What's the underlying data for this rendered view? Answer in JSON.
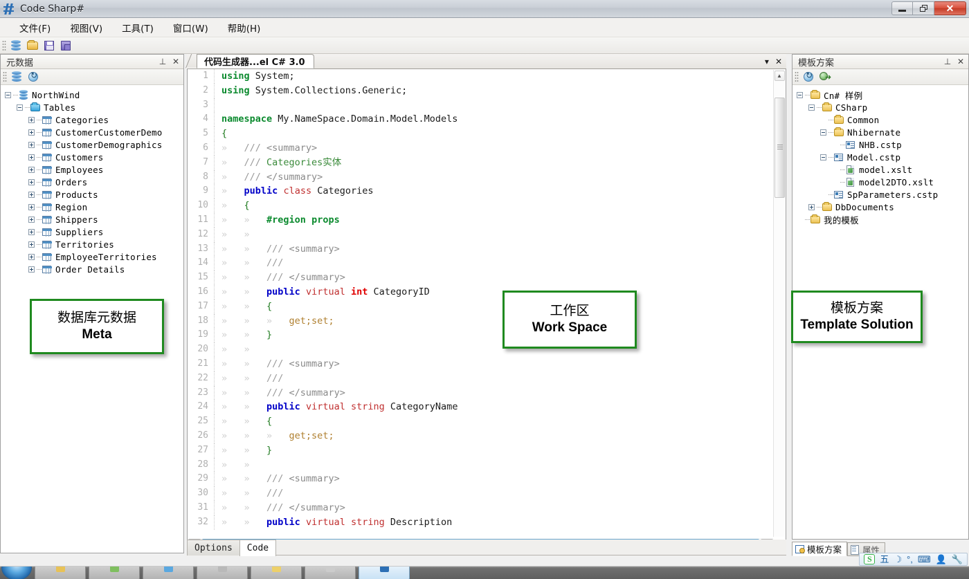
{
  "window": {
    "title": "Code Sharp#",
    "icon": "hash-logo-icon",
    "minimize_label": "",
    "restore_label": "",
    "close_label": "✕"
  },
  "menu": {
    "items": [
      {
        "label": "文件(F)",
        "name": "menu-file"
      },
      {
        "label": "视图(V)",
        "name": "menu-view"
      },
      {
        "label": "工具(T)",
        "name": "menu-tools"
      },
      {
        "label": "窗口(W)",
        "name": "menu-window"
      },
      {
        "label": "帮助(H)",
        "name": "menu-help"
      }
    ]
  },
  "toolbar": {
    "buttons": [
      {
        "icon": "database-icon",
        "name": "toolbar-connect-database"
      },
      {
        "icon": "open-folder-icon",
        "name": "toolbar-open"
      },
      {
        "icon": "save-icon",
        "name": "toolbar-save"
      },
      {
        "icon": "save-all-icon",
        "name": "toolbar-save-all"
      }
    ]
  },
  "left_panel": {
    "title": "元数据",
    "pin_glyph": "⊥",
    "close_glyph": "✕",
    "toolbar": [
      {
        "icon": "database-icon",
        "name": "meta-database-button"
      },
      {
        "icon": "refresh-icon",
        "name": "meta-refresh-button"
      }
    ],
    "tree": [
      {
        "label": "NorthWind",
        "depth": 0,
        "toggle": "minus",
        "icon": "database-icon"
      },
      {
        "label": "Tables",
        "depth": 1,
        "toggle": "minus",
        "icon": "folder-blue-icon"
      },
      {
        "label": "Categories",
        "depth": 2,
        "toggle": "plus",
        "icon": "table-icon"
      },
      {
        "label": "CustomerCustomerDemo",
        "depth": 2,
        "toggle": "plus",
        "icon": "table-icon"
      },
      {
        "label": "CustomerDemographics",
        "depth": 2,
        "toggle": "plus",
        "icon": "table-icon"
      },
      {
        "label": "Customers",
        "depth": 2,
        "toggle": "plus",
        "icon": "table-icon"
      },
      {
        "label": "Employees",
        "depth": 2,
        "toggle": "plus",
        "icon": "table-icon"
      },
      {
        "label": "Orders",
        "depth": 2,
        "toggle": "plus",
        "icon": "table-icon"
      },
      {
        "label": "Products",
        "depth": 2,
        "toggle": "plus",
        "icon": "table-icon"
      },
      {
        "label": "Region",
        "depth": 2,
        "toggle": "plus",
        "icon": "table-icon"
      },
      {
        "label": "Shippers",
        "depth": 2,
        "toggle": "plus",
        "icon": "table-icon"
      },
      {
        "label": "Suppliers",
        "depth": 2,
        "toggle": "plus",
        "icon": "table-icon"
      },
      {
        "label": "Territories",
        "depth": 2,
        "toggle": "plus",
        "icon": "table-icon"
      },
      {
        "label": "EmployeeTerritories",
        "depth": 2,
        "toggle": "plus",
        "icon": "table-icon"
      },
      {
        "label": "Order Details",
        "depth": 2,
        "toggle": "plus",
        "icon": "table-icon"
      }
    ]
  },
  "editor": {
    "tab_label": "代码生成器...el C# 3.0",
    "tab_menu_glyph": "▾",
    "tab_close_glyph": "✕",
    "bottom_tabs": [
      {
        "label": "Options",
        "active": false
      },
      {
        "label": "Code",
        "active": true
      }
    ],
    "code": [
      {
        "n": "1",
        "indents": 0,
        "tokens": [
          {
            "t": "using",
            "c": "kw"
          },
          {
            "t": " System;",
            "c": "plain"
          }
        ]
      },
      {
        "n": "2",
        "indents": 0,
        "tokens": [
          {
            "t": "using",
            "c": "kw"
          },
          {
            "t": " System.Collections.Generic;",
            "c": "plain"
          }
        ]
      },
      {
        "n": "3",
        "indents": 0,
        "tokens": []
      },
      {
        "n": "4",
        "indents": 0,
        "tokens": [
          {
            "t": "namespace",
            "c": "kw"
          },
          {
            "t": " My.NameSpace.Domain.Model.Models",
            "c": "plain"
          }
        ]
      },
      {
        "n": "5",
        "indents": 0,
        "tokens": [
          {
            "t": "{",
            "c": "brc"
          }
        ]
      },
      {
        "n": "6",
        "indents": 1,
        "tokens": [
          {
            "t": "/// ",
            "c": "cmt"
          },
          {
            "t": "<summary>",
            "c": "tag"
          }
        ]
      },
      {
        "n": "7",
        "indents": 1,
        "tokens": [
          {
            "t": "/// ",
            "c": "cmt"
          },
          {
            "t": "Categories实体",
            "c": "cmt2"
          }
        ]
      },
      {
        "n": "8",
        "indents": 1,
        "tokens": [
          {
            "t": "/// ",
            "c": "cmt"
          },
          {
            "t": "</summary>",
            "c": "tag"
          }
        ]
      },
      {
        "n": "9",
        "indents": 1,
        "tokens": [
          {
            "t": "public",
            "c": "kw2"
          },
          {
            "t": " ",
            "c": "plain"
          },
          {
            "t": "class",
            "c": "kwr"
          },
          {
            "t": " Categories",
            "c": "plain"
          }
        ]
      },
      {
        "n": "10",
        "indents": 1,
        "tokens": [
          {
            "t": "{",
            "c": "brc"
          }
        ]
      },
      {
        "n": "11",
        "indents": 2,
        "tokens": [
          {
            "t": "#region",
            "c": "pre"
          },
          {
            "t": " props",
            "c": "kw"
          }
        ]
      },
      {
        "n": "12",
        "indents": 2,
        "tokens": []
      },
      {
        "n": "13",
        "indents": 2,
        "tokens": [
          {
            "t": "/// ",
            "c": "cmt"
          },
          {
            "t": "<summary>",
            "c": "tag"
          }
        ]
      },
      {
        "n": "14",
        "indents": 2,
        "tokens": [
          {
            "t": "///",
            "c": "cmt"
          }
        ]
      },
      {
        "n": "15",
        "indents": 2,
        "tokens": [
          {
            "t": "/// ",
            "c": "cmt"
          },
          {
            "t": "</summary>",
            "c": "tag"
          }
        ]
      },
      {
        "n": "16",
        "indents": 2,
        "tokens": [
          {
            "t": "public",
            "c": "kw2"
          },
          {
            "t": " ",
            "c": "plain"
          },
          {
            "t": "virtual",
            "c": "kwr"
          },
          {
            "t": " ",
            "c": "plain"
          },
          {
            "t": "int",
            "c": "kwr2"
          },
          {
            "t": " CategoryID",
            "c": "plain"
          }
        ]
      },
      {
        "n": "17",
        "indents": 2,
        "tokens": [
          {
            "t": "{",
            "c": "brc"
          }
        ]
      },
      {
        "n": "18",
        "indents": 3,
        "tokens": [
          {
            "t": "get;set;",
            "c": "gs"
          }
        ]
      },
      {
        "n": "19",
        "indents": 2,
        "tokens": [
          {
            "t": "}",
            "c": "brc"
          }
        ]
      },
      {
        "n": "20",
        "indents": 2,
        "tokens": []
      },
      {
        "n": "21",
        "indents": 2,
        "tokens": [
          {
            "t": "/// ",
            "c": "cmt"
          },
          {
            "t": "<summary>",
            "c": "tag"
          }
        ]
      },
      {
        "n": "22",
        "indents": 2,
        "tokens": [
          {
            "t": "///",
            "c": "cmt"
          }
        ]
      },
      {
        "n": "23",
        "indents": 2,
        "tokens": [
          {
            "t": "/// ",
            "c": "cmt"
          },
          {
            "t": "</summary>",
            "c": "tag"
          }
        ]
      },
      {
        "n": "24",
        "indents": 2,
        "tokens": [
          {
            "t": "public",
            "c": "kw2"
          },
          {
            "t": " ",
            "c": "plain"
          },
          {
            "t": "virtual",
            "c": "kwr"
          },
          {
            "t": " ",
            "c": "plain"
          },
          {
            "t": "string",
            "c": "kwr"
          },
          {
            "t": " CategoryName",
            "c": "plain"
          }
        ]
      },
      {
        "n": "25",
        "indents": 2,
        "tokens": [
          {
            "t": "{",
            "c": "brc"
          }
        ]
      },
      {
        "n": "26",
        "indents": 3,
        "tokens": [
          {
            "t": "get;set;",
            "c": "gs"
          }
        ]
      },
      {
        "n": "27",
        "indents": 2,
        "tokens": [
          {
            "t": "}",
            "c": "brc"
          }
        ]
      },
      {
        "n": "28",
        "indents": 2,
        "tokens": []
      },
      {
        "n": "29",
        "indents": 2,
        "tokens": [
          {
            "t": "/// ",
            "c": "cmt"
          },
          {
            "t": "<summary>",
            "c": "tag"
          }
        ]
      },
      {
        "n": "30",
        "indents": 2,
        "tokens": [
          {
            "t": "///",
            "c": "cmt"
          }
        ]
      },
      {
        "n": "31",
        "indents": 2,
        "tokens": [
          {
            "t": "/// ",
            "c": "cmt"
          },
          {
            "t": "</summary>",
            "c": "tag"
          }
        ]
      },
      {
        "n": "32",
        "indents": 2,
        "tokens": [
          {
            "t": "public",
            "c": "kw2"
          },
          {
            "t": " ",
            "c": "plain"
          },
          {
            "t": "virtual",
            "c": "kwr"
          },
          {
            "t": " ",
            "c": "plain"
          },
          {
            "t": "string",
            "c": "kwr"
          },
          {
            "t": " Description",
            "c": "plain"
          }
        ]
      }
    ]
  },
  "right_panel": {
    "title": "模板方案",
    "pin_glyph": "⊥",
    "close_glyph": "✕",
    "toolbar": [
      {
        "icon": "refresh-icon",
        "name": "template-refresh-button"
      },
      {
        "icon": "generate-icon",
        "name": "template-generate-button"
      }
    ],
    "tree": [
      {
        "label": "Cn# 样例",
        "depth": 0,
        "toggle": "minus",
        "icon": "folder-icon"
      },
      {
        "label": "CSharp",
        "depth": 1,
        "toggle": "minus",
        "icon": "folder-icon"
      },
      {
        "label": "Common",
        "depth": 2,
        "toggle": "none",
        "icon": "folder-icon"
      },
      {
        "label": "Nhibernate",
        "depth": 2,
        "toggle": "minus",
        "icon": "folder-icon"
      },
      {
        "label": "NHB.cstp",
        "depth": 3,
        "toggle": "none",
        "icon": "cstp-icon"
      },
      {
        "label": "Model.cstp",
        "depth": 2,
        "toggle": "minus",
        "icon": "cstp-icon"
      },
      {
        "label": "model.xslt",
        "depth": 3,
        "toggle": "none",
        "icon": "xslt-icon"
      },
      {
        "label": "model2DTO.xslt",
        "depth": 3,
        "toggle": "none",
        "icon": "xslt-icon"
      },
      {
        "label": "SpParameters.cstp",
        "depth": 2,
        "toggle": "none",
        "icon": "cstp-icon"
      },
      {
        "label": "DbDocuments",
        "depth": 1,
        "toggle": "plus",
        "icon": "folder-icon"
      },
      {
        "label": "我的模板",
        "depth": 0,
        "toggle": "none",
        "icon": "folder-icon"
      }
    ],
    "bottom_tabs": [
      {
        "label": "模板方案",
        "active": true,
        "icon": "solution-icon"
      },
      {
        "label": "属性",
        "active": false,
        "icon": "properties-icon"
      }
    ]
  },
  "annotations": [
    {
      "name": "annotation-meta",
      "line1": "数据库元数据",
      "line2": "Meta"
    },
    {
      "name": "annotation-workspace",
      "line1": "工作区",
      "line2": "Work Space"
    },
    {
      "name": "annotation-template",
      "line1": "模板方案",
      "line2": "Template Solution"
    }
  ],
  "ime": {
    "logo": "S",
    "items": [
      "五",
      "☽",
      "°,",
      "⌨",
      "👤",
      "🔧"
    ]
  },
  "colors": {
    "annotation_border": "#1f8a1f",
    "close_button": "#d9503c",
    "scrollbar_accent": "#9fd4f3",
    "keyword_green": "#0b8a2e",
    "keyword_blue": "#0000c8",
    "type_red": "#c03030",
    "comment_gray": "#9a9a9a"
  }
}
